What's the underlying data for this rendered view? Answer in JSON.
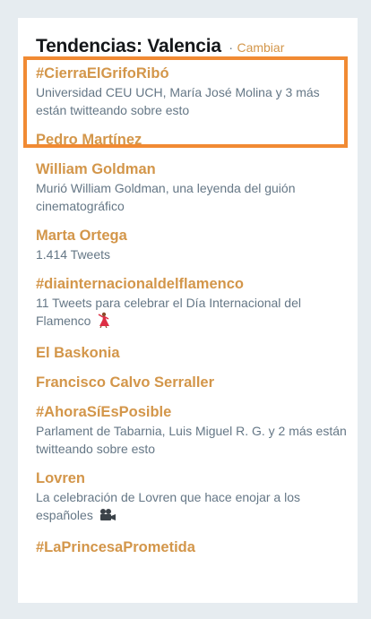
{
  "header": {
    "title": "Tendencias: Valencia",
    "separator": "·",
    "change_link": "Cambiar"
  },
  "colors": {
    "accent": "#d3964a",
    "highlight_border": "#f18a33",
    "secondary_text": "#657786",
    "background": "#e6ecf0"
  },
  "trends": [
    {
      "name": "#CierraElGrifoRibó",
      "description": "Universidad CEU UCH, María José Molina y 3 más están twitteando sobre esto",
      "highlighted": true
    },
    {
      "name": "Pedro Martínez",
      "description": ""
    },
    {
      "name": "William Goldman",
      "description": "Murió William Goldman, una leyenda del guión cinematográfico"
    },
    {
      "name": "Marta Ortega",
      "description": "1.414 Tweets"
    },
    {
      "name": "#diainternacionaldelflamenco",
      "description": "11 Tweets para celebrar el Día Internacional del Flamenco",
      "emoji": "dancer-emoji"
    },
    {
      "name": "El Baskonia",
      "description": ""
    },
    {
      "name": "Francisco Calvo Serraller",
      "description": ""
    },
    {
      "name": "#AhoraSíEsPosible",
      "description": "Parlament de Tabarnia, Luis Miguel R. G. y 2 más están twitteando sobre esto"
    },
    {
      "name": "Lovren",
      "description": "La celebración de Lovren que hace enojar a los españoles",
      "emoji": "movie-camera-emoji"
    },
    {
      "name": "#LaPrincesaPrometida",
      "description": ""
    }
  ]
}
